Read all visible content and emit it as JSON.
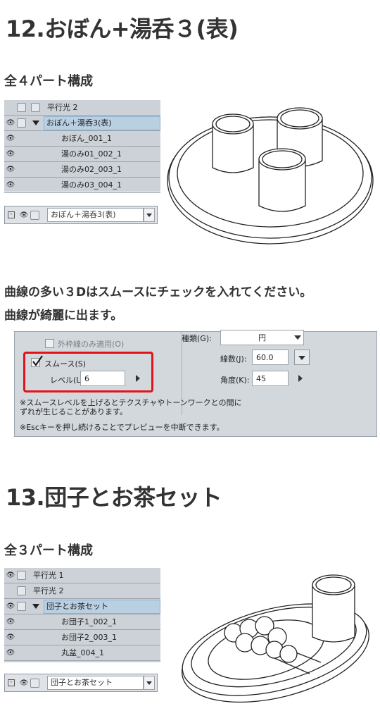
{
  "section12": {
    "title": "12.おぼん+湯呑３(表)",
    "parts": "全４パート構成",
    "layers": [
      {
        "name": "平行光 2"
      },
      {
        "name": "おぼん＋湯呑3(表)"
      },
      {
        "name": "おぼん_001_1"
      },
      {
        "name": "湯のみ01_002_1"
      },
      {
        "name": "湯のみ02_003_1"
      },
      {
        "name": "湯のみ03_004_1"
      }
    ],
    "bottom_layer": "おぼん＋湯呑3(表)",
    "note_line1": "曲線の多い３Dはスムースにチェックを入れてください。",
    "note_line2": "曲線が綺麗に出ます。"
  },
  "settings": {
    "outline_only": "外枠線のみ適用(O)",
    "smooth_label": "スムース(S)",
    "level_label": "レベル(L):",
    "level_value": "6",
    "type_label": "種類(G):",
    "type_value": "円",
    "lines_label": "線数(J):",
    "lines_value": "60.0",
    "angle_label": "角度(K):",
    "angle_value": "45",
    "info1a": "※スムースレベルを上げるとテクスチャやトーンワークとの間に",
    "info1b": "ずれが生じることがあります。",
    "info2": "※Escキーを押し続けることでプレビューを中断できます。"
  },
  "section13": {
    "title": "13.団子とお茶セット",
    "parts": "全３パート構成",
    "layers": [
      {
        "name": "平行光 1"
      },
      {
        "name": "平行光 2"
      },
      {
        "name": "団子とお茶セット"
      },
      {
        "name": "お団子1_002_1"
      },
      {
        "name": "お団子2_003_1"
      },
      {
        "name": "丸盆_004_1"
      }
    ],
    "bottom_layer": "団子とお茶セット"
  }
}
